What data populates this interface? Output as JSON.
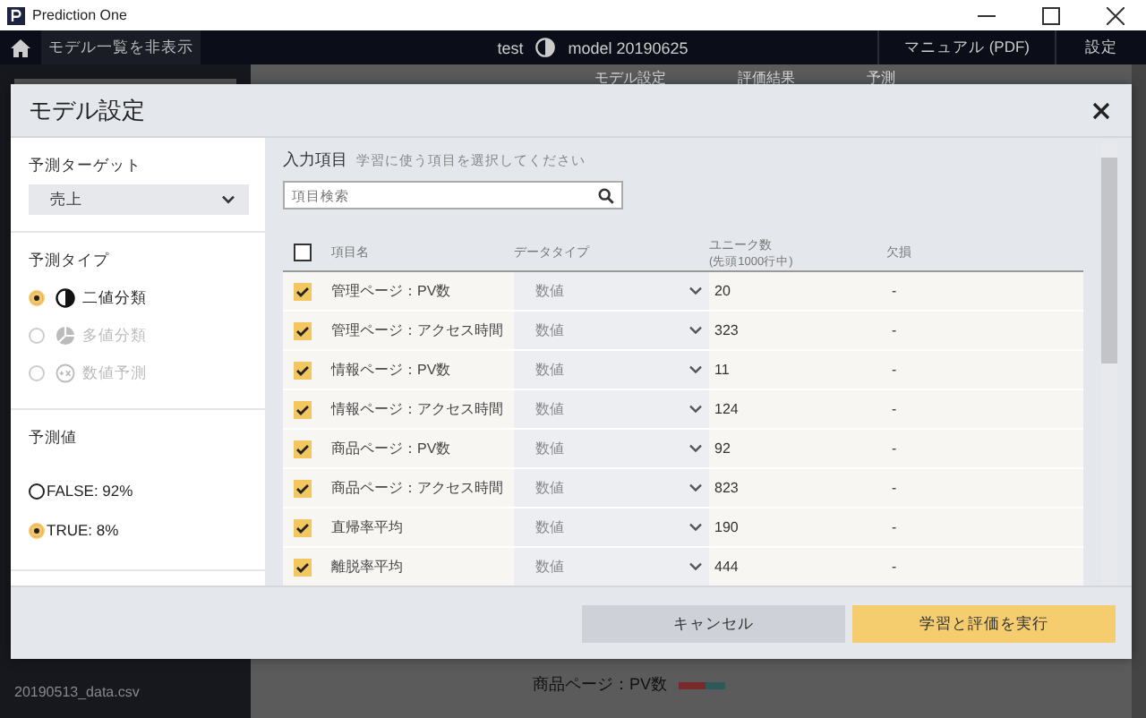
{
  "window": {
    "title": "Prediction One"
  },
  "app_header": {
    "toggle": "モデル一覧を非表示",
    "project": "test",
    "model": "model 20190625",
    "manual": "マニュアル (PDF)",
    "settings": "設定"
  },
  "background": {
    "tabs": [
      "モデル設定",
      "評価結果",
      "予測"
    ],
    "file": "20190513_data.csv",
    "feature_label": "商品ページ：PV数"
  },
  "modal": {
    "title": "モデル設定",
    "target": {
      "label": "予測ターゲット",
      "value": "売上"
    },
    "type": {
      "label": "予測タイプ",
      "options": [
        {
          "kind": "binary",
          "label": "二値分類",
          "selected": true,
          "disabled": false
        },
        {
          "kind": "multiclass",
          "label": "多値分類",
          "selected": false,
          "disabled": true
        },
        {
          "kind": "regression",
          "label": "数値予測",
          "selected": false,
          "disabled": true
        }
      ]
    },
    "positive": {
      "label": "予測値",
      "options": [
        {
          "label": "FALSE: 92%",
          "selected": false
        },
        {
          "label": "TRUE: 8%",
          "selected": true
        }
      ]
    },
    "inputs": {
      "title": "入力項目",
      "hint": "学習に使う項目を選択してください",
      "search_placeholder": "項目検索",
      "select_all": {
        "checked": false
      },
      "columns": {
        "name": "項目名",
        "data_type": "データタイプ",
        "unique": "ユニーク数",
        "unique_note": "(先頭1000行中)",
        "missing": "欠損"
      },
      "rows": [
        {
          "checked": true,
          "name": "管理ページ：PV数",
          "data_type": "数値",
          "unique": "20",
          "missing": "-"
        },
        {
          "checked": true,
          "name": "管理ページ：アクセス時間",
          "data_type": "数値",
          "unique": "323",
          "missing": "-"
        },
        {
          "checked": true,
          "name": "情報ページ：PV数",
          "data_type": "数値",
          "unique": "11",
          "missing": "-"
        },
        {
          "checked": true,
          "name": "情報ページ：アクセス時間",
          "data_type": "数値",
          "unique": "124",
          "missing": "-"
        },
        {
          "checked": true,
          "name": "商品ページ：PV数",
          "data_type": "数値",
          "unique": "92",
          "missing": "-"
        },
        {
          "checked": true,
          "name": "商品ページ：アクセス時間",
          "data_type": "数値",
          "unique": "823",
          "missing": "-"
        },
        {
          "checked": true,
          "name": "直帰率平均",
          "data_type": "数値",
          "unique": "190",
          "missing": "-"
        },
        {
          "checked": true,
          "name": "離脱率平均",
          "data_type": "数値",
          "unique": "444",
          "missing": "-"
        }
      ]
    },
    "buttons": {
      "cancel": "キャンセル",
      "run": "学習と評価を実行"
    }
  }
}
